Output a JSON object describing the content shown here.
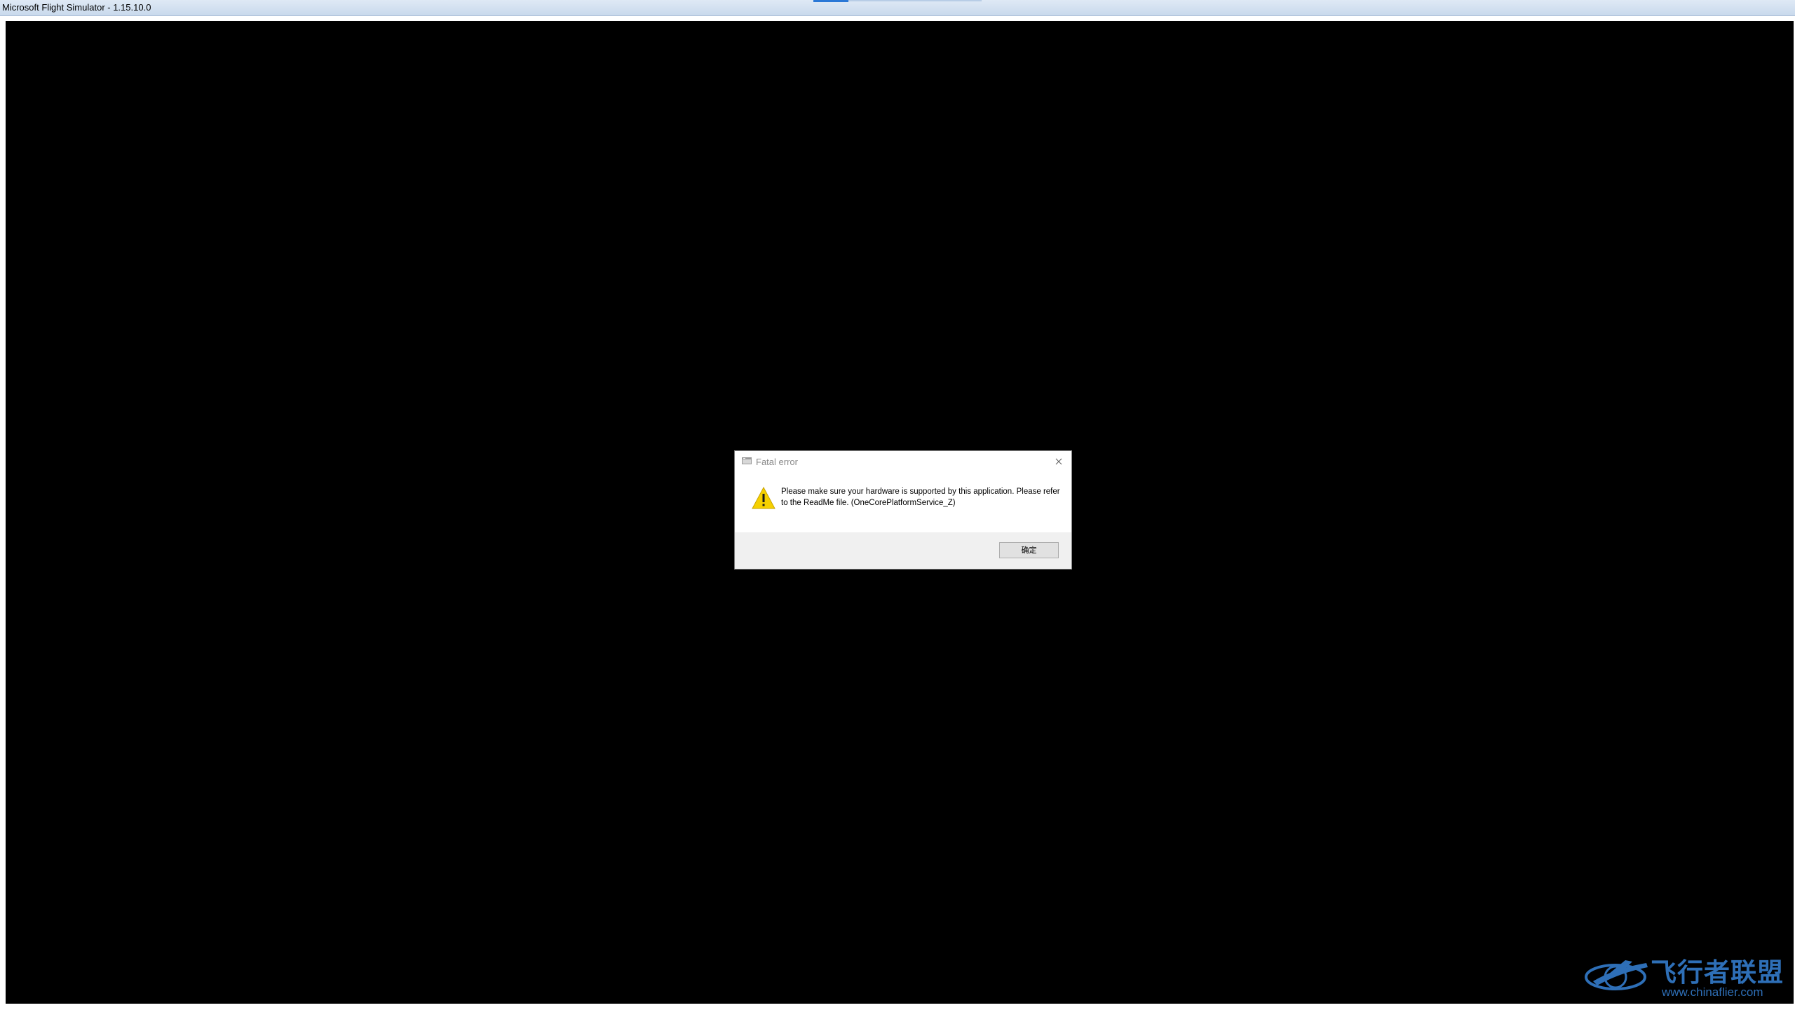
{
  "window": {
    "title": "Microsoft Flight Simulator - 1.15.10.0"
  },
  "dialog": {
    "title": "Fatal error",
    "icon": "warning-icon",
    "message": "Please make sure your hardware is supported by this application. Please refer to the ReadMe file. (OneCorePlatformService_Z)",
    "ok_label": "确定"
  },
  "watermark": {
    "name": "飞行者联盟",
    "url": "www.chinaflier.com"
  },
  "colors": {
    "viewport": "#000000",
    "dialog_footer": "#f0f0f0",
    "warning_yellow": "#f5d000",
    "watermark_blue": "#2e6fb7"
  }
}
